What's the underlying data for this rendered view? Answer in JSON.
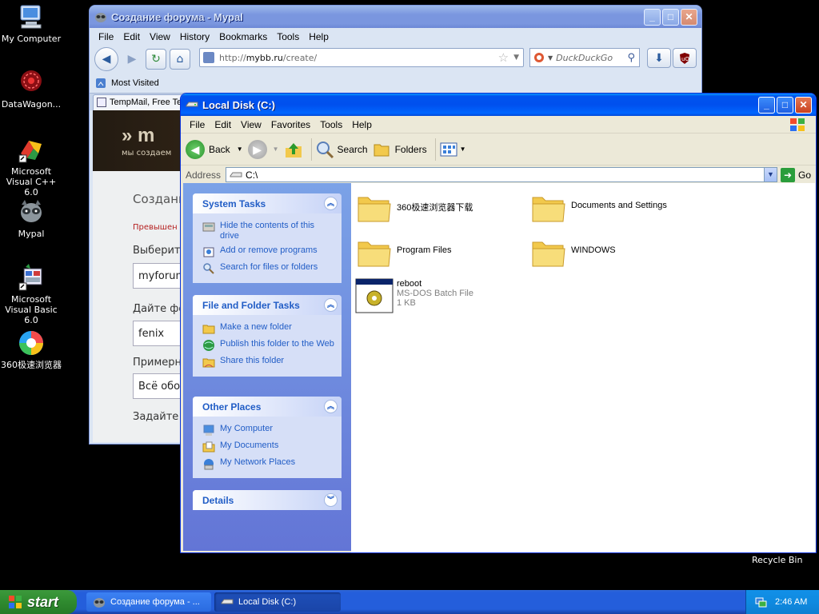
{
  "desktop": {
    "icons": [
      {
        "label": "My Computer",
        "icon": "my-computer-icon"
      },
      {
        "label": "DataWagon...",
        "icon": "datawagon-icon"
      },
      {
        "label": "Microsoft Visual C++ 6.0",
        "icon": "visual-cpp-icon"
      },
      {
        "label": "Mypal",
        "icon": "mypal-icon"
      },
      {
        "label": "Microsoft Visual Basic 6.0",
        "icon": "visual-basic-icon"
      },
      {
        "label": "360极速浏览器",
        "icon": "360-browser-icon"
      }
    ],
    "recycle_bin": "Recycle Bin"
  },
  "firefox": {
    "title": "Создание форума - Mypal",
    "menu": [
      "File",
      "Edit",
      "View",
      "History",
      "Bookmarks",
      "Tools",
      "Help"
    ],
    "url_prefix": "http://",
    "url_host": "mybb.ru",
    "url_path": "/create/",
    "search_placeholder": "DuckDuckGo",
    "bookmark": "Most Visited",
    "tab_label": "TempMail, Free Te",
    "banner_logo": "» m",
    "banner_sub": "мы создаем",
    "page": {
      "heading": "Создани",
      "warning": "Превышен л",
      "label1": "Выберите",
      "input1": "myforum",
      "label2": "Дайте фо",
      "input2": "fenix",
      "label3": "Примерна",
      "input3": "Всё обо",
      "label4": "Задайте"
    }
  },
  "explorer": {
    "title": "Local Disk (C:)",
    "menu": [
      "File",
      "Edit",
      "View",
      "Favorites",
      "Tools",
      "Help"
    ],
    "toolbar": {
      "back": "Back",
      "search": "Search",
      "folders": "Folders"
    },
    "address_label": "Address",
    "address_value": "C:\\",
    "go": "Go",
    "system_tasks": {
      "title": "System Tasks",
      "items": [
        "Hide the contents of this drive",
        "Add or remove programs",
        "Search for files or folders"
      ]
    },
    "file_folder_tasks": {
      "title": "File and Folder Tasks",
      "items": [
        "Make a new folder",
        "Publish this folder to the Web",
        "Share this folder"
      ]
    },
    "other_places": {
      "title": "Other Places",
      "items": [
        "My Computer",
        "My Documents",
        "My Network Places"
      ]
    },
    "details": {
      "title": "Details"
    },
    "files": [
      {
        "name": "360极速浏览器下载",
        "type": "folder"
      },
      {
        "name": "Documents and Settings",
        "type": "folder"
      },
      {
        "name": "Program Files",
        "type": "folder"
      },
      {
        "name": "WINDOWS",
        "type": "folder"
      },
      {
        "name": "reboot",
        "type": "batch",
        "desc": "MS-DOS Batch File",
        "size": "1 KB"
      }
    ]
  },
  "taskbar": {
    "start": "start",
    "tasks": [
      "Создание форума - ...",
      "Local Disk (C:)"
    ],
    "clock": "2:46 AM"
  },
  "colors": {
    "xp_blue": "#0053ee",
    "explorer_pane": "#6375d6",
    "link_blue": "#215dc6",
    "start_green": "#2f8a2f"
  }
}
